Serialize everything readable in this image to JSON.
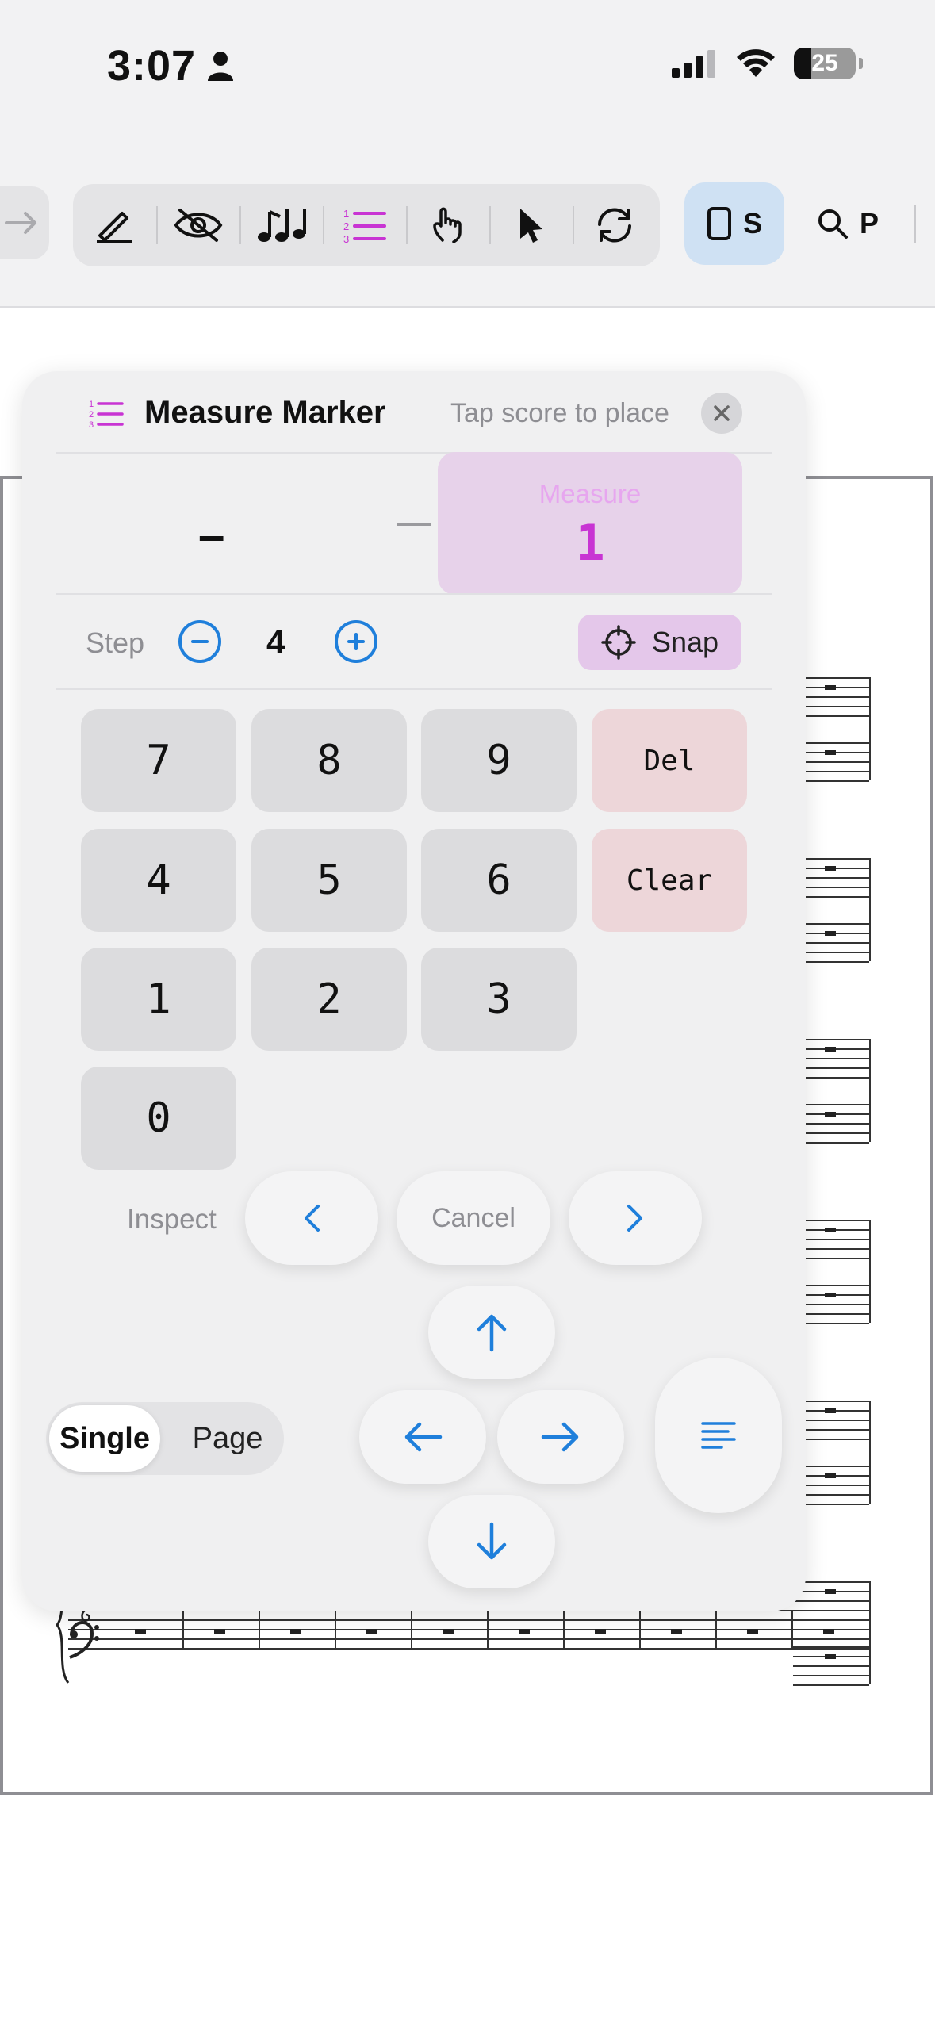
{
  "status_bar": {
    "time": "3:07",
    "battery": "25"
  },
  "toolbar": {
    "score_label": "S",
    "search_label": "P",
    "tools": [
      "pen-icon",
      "hide-icon",
      "notes-icon",
      "list-numbered-icon",
      "hand-touch-icon",
      "pointer-icon",
      "sync-icon"
    ]
  },
  "panel": {
    "title": "Measure Marker",
    "hint": "Tap score to place",
    "left_value": "–",
    "measure_label": "Measure",
    "measure_value": "1",
    "step_label": "Step",
    "step_value": "4",
    "snap_label": "Snap",
    "keys": {
      "k7": "7",
      "k8": "8",
      "k9": "9",
      "del": "Del",
      "k4": "4",
      "k5": "5",
      "k6": "6",
      "clear": "Clear",
      "k1": "1",
      "k2": "2",
      "k3": "3",
      "k0": "0"
    },
    "inspect_label": "Inspect",
    "cancel_label": "Cancel",
    "view_mode": {
      "single": "Single",
      "page": "Page",
      "selected": "Single"
    }
  },
  "colors": {
    "accent": "#1f7fdb",
    "marker": "#c834d3",
    "measure_bg": "#e7d2ea",
    "del_bg": "#edd6d9"
  }
}
